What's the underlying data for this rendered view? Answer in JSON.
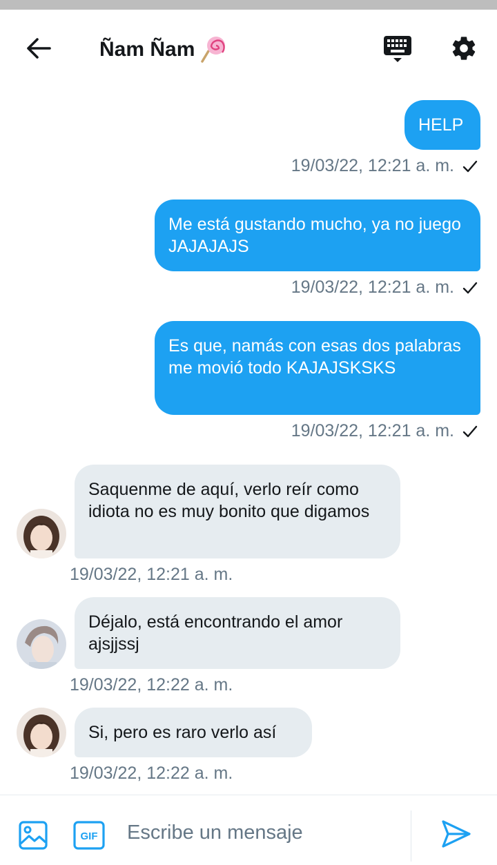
{
  "header": {
    "title": "Ñam Ñam",
    "back_icon": "arrow-left-icon",
    "keyboard_icon": "keyboard-icon",
    "settings_icon": "gear-icon",
    "title_emoji": "lollipop-icon"
  },
  "colors": {
    "accent": "#1da1f2",
    "received_bubble": "#e6ecf0",
    "meta_text": "#657786"
  },
  "messages": [
    {
      "direction": "sent",
      "text": "HELP",
      "time": "19/03/22, 12:21 a. m.",
      "status_icon": "check-icon"
    },
    {
      "direction": "sent",
      "text": "Me está gustando mucho, ya no juego JAJAJAJS",
      "time": "19/03/22, 12:21 a. m.",
      "status_icon": "check-icon"
    },
    {
      "direction": "sent",
      "text": "Es que, namás con esas dos palabras me movió todo KAJAJSKSKS",
      "time": "19/03/22, 12:21 a. m.",
      "status_icon": "check-icon"
    },
    {
      "direction": "received",
      "text": "Saquenme de aquí, verlo reír como idiota no es muy bonito que digamos",
      "time": "19/03/22, 12:21 a. m."
    },
    {
      "direction": "received",
      "text": "Déjalo, está encontrando el amor ajsjjssj",
      "time": "19/03/22, 12:22 a. m."
    },
    {
      "direction": "received",
      "text": "Si, pero es raro verlo así",
      "time": "19/03/22, 12:22 a. m."
    }
  ],
  "composer": {
    "placeholder": "Escribe un mensaje",
    "gif_label": "GIF",
    "media_icon": "image-icon",
    "send_icon": "send-icon"
  }
}
